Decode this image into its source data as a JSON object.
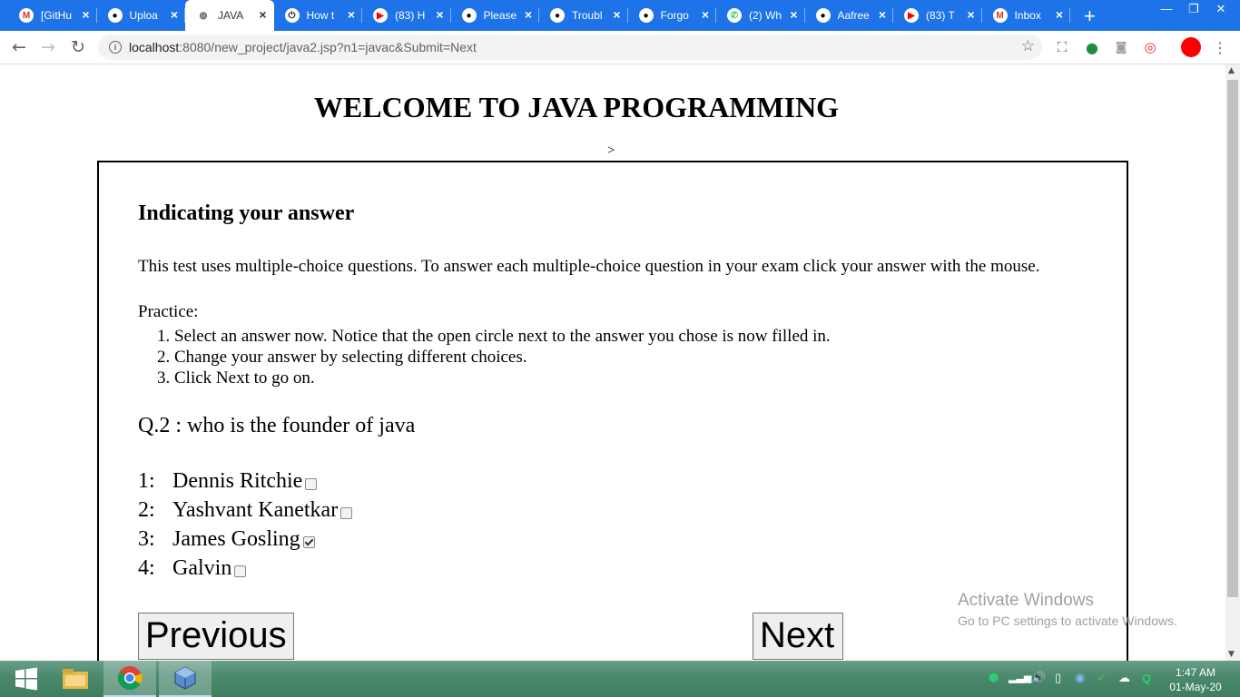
{
  "tabs": [
    {
      "title": "[GitHu",
      "icon": "gmail-icon",
      "color": "#d93025",
      "glyph": "M"
    },
    {
      "title": "Uploa",
      "icon": "github-icon",
      "color": "#000000",
      "glyph": "●"
    },
    {
      "title": "JAVA",
      "icon": "globe-icon",
      "color": "#5f6368",
      "glyph": "◍",
      "active": true
    },
    {
      "title": "How t",
      "icon": "power-icon",
      "color": "#111111",
      "glyph": "⏻"
    },
    {
      "title": "(83) H",
      "icon": "youtube-icon",
      "color": "#ff0000",
      "glyph": "▶"
    },
    {
      "title": "Please",
      "icon": "github-icon",
      "color": "#000000",
      "glyph": "●"
    },
    {
      "title": "Troubl",
      "icon": "github-icon",
      "color": "#000000",
      "glyph": "●"
    },
    {
      "title": "Forgo",
      "icon": "github-icon",
      "color": "#000000",
      "glyph": "●"
    },
    {
      "title": "(2) Wh",
      "icon": "whatsapp-icon",
      "color": "#25d366",
      "glyph": "✆"
    },
    {
      "title": "Aafree",
      "icon": "github-icon",
      "color": "#000000",
      "glyph": "●"
    },
    {
      "title": "(83) T",
      "icon": "youtube-icon",
      "color": "#ff0000",
      "glyph": "▶"
    },
    {
      "title": "Inbox",
      "icon": "gmail-icon",
      "color": "#d93025",
      "glyph": "M"
    }
  ],
  "toolbar": {
    "url_host": "localhost",
    "url_path": ":8080/new_project/java2.jsp?n1=javac&Submit=Next"
  },
  "page": {
    "heading": "WELCOME TO JAVA PROGRAMMING",
    "stray_text": ">",
    "subheading": "Indicating your answer",
    "intro": "This test uses multiple-choice questions. To answer each multiple-choice question in your exam click your answer with the mouse.",
    "practice_label": "Practice:",
    "steps": [
      "Select an answer now. Notice that the open circle next to the answer you chose is now filled in.",
      "Change your answer by selecting different choices.",
      "Click Next to go on."
    ],
    "question": "Q.2 : who is the founder of java",
    "options": [
      {
        "num": "1:",
        "label": "Dennis Ritchie",
        "checked": false
      },
      {
        "num": "2:",
        "label": "Yashvant Kanetkar",
        "checked": false
      },
      {
        "num": "3:",
        "label": "James Gosling",
        "checked": true
      },
      {
        "num": "4:",
        "label": "Galvin",
        "checked": false
      }
    ],
    "previous_label": "Previous",
    "next_label": "Next"
  },
  "watermark": {
    "line1": "Activate Windows",
    "line2": "Go to PC settings to activate Windows."
  },
  "taskbar": {
    "time": "1:47 AM",
    "date": "01-May-20"
  }
}
